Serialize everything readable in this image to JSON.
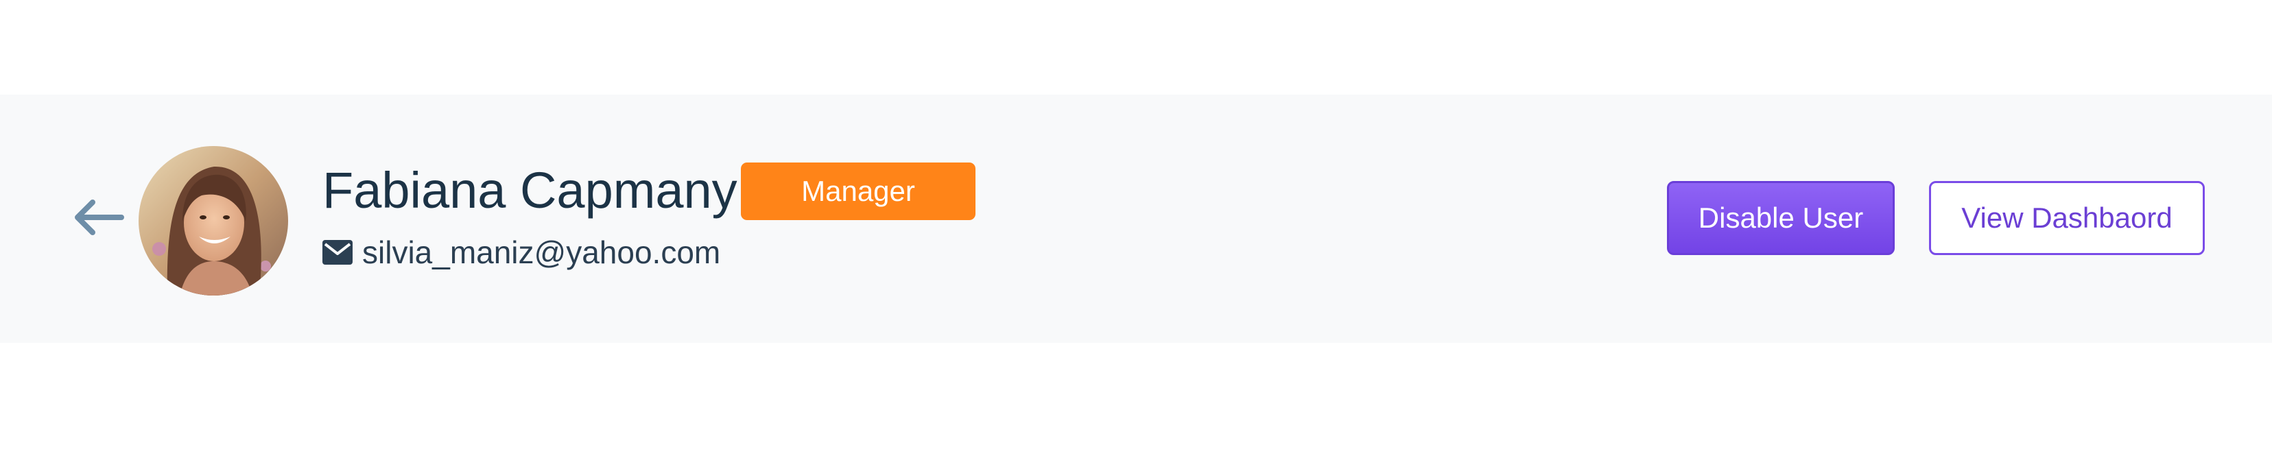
{
  "user": {
    "name": "Fabiana Capmany",
    "role": "Manager",
    "email": "silvia_maniz@yahoo.com"
  },
  "actions": {
    "disable_label": "Disable User",
    "dashboard_label": "View Dashbaord"
  },
  "icons": {
    "back": "arrow-left-icon",
    "email": "envelope-icon"
  },
  "colors": {
    "background": "#f8f9fa",
    "role_badge": "#ff8418",
    "primary": "#7a4ce8",
    "name_text": "#1c3346",
    "back_arrow": "#6e8ea8"
  }
}
